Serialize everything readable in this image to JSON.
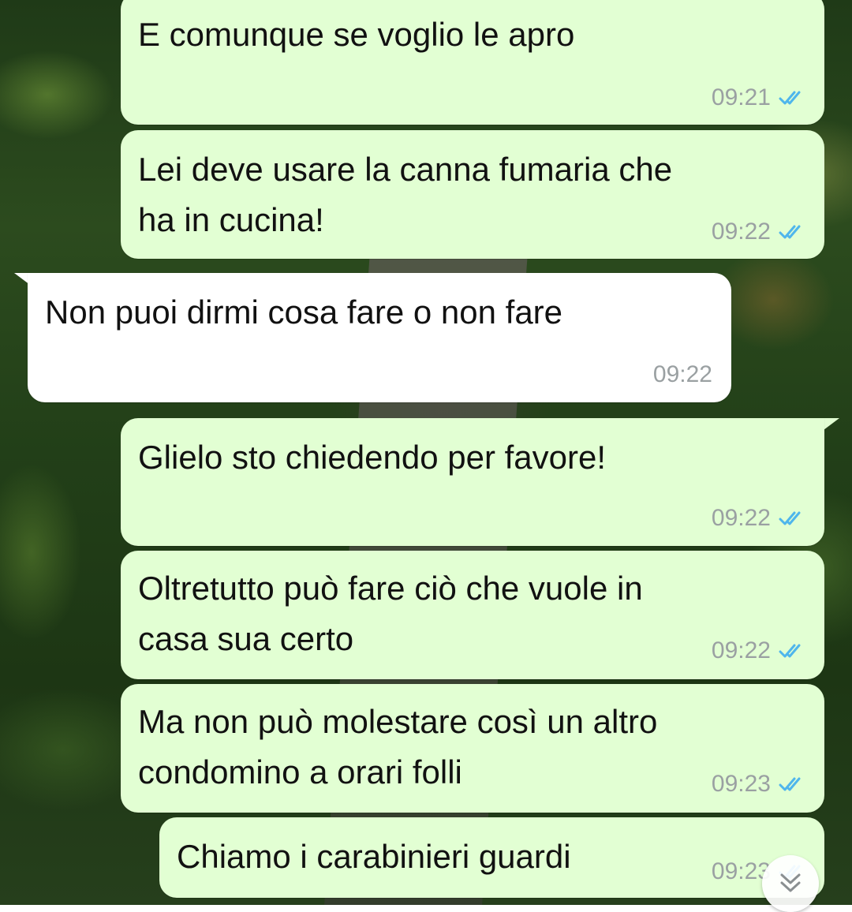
{
  "wallpaper": {
    "description_icon": "forest-road-wallpaper"
  },
  "colors": {
    "outgoing_bubble": "#e2ffd3",
    "incoming_bubble": "#ffffff",
    "read_ticks": "#4fb6ec",
    "timestamp": "#9aa0a2"
  },
  "messages": [
    {
      "direction": "out",
      "text": "E comunque se voglio le apro",
      "time": "09:21",
      "status": "read"
    },
    {
      "direction": "out",
      "text": "Lei deve usare la canna fumaria che\nha in cucina!",
      "time": "09:22",
      "status": "read"
    },
    {
      "direction": "in",
      "text": "Non puoi dirmi cosa fare o non fare",
      "time": "09:22"
    },
    {
      "direction": "out",
      "text": "Glielo sto chiedendo per favore!",
      "time": "09:22",
      "status": "read"
    },
    {
      "direction": "out",
      "text": "Oltretutto può fare ciò che vuole in\ncasa sua certo",
      "time": "09:22",
      "status": "read"
    },
    {
      "direction": "out",
      "text": "Ma non può molestare così un altro\ncondomino a orari folli",
      "time": "09:23",
      "status": "read"
    },
    {
      "direction": "out",
      "text": "Chiamo i carabinieri guardi",
      "time": "09:23",
      "status": "read"
    }
  ],
  "scroll_button": {
    "icon": "double-chevron-down-icon"
  }
}
